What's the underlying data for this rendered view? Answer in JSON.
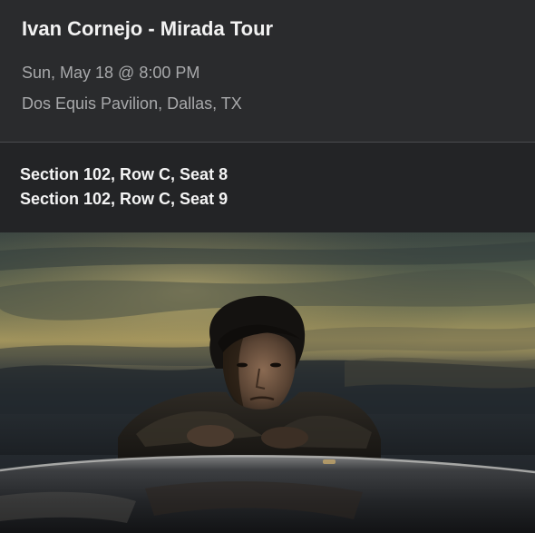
{
  "event": {
    "title": "Ivan Cornejo - Mirada Tour",
    "datetime": "Sun, May 18 @ 8:00 PM",
    "venue": "Dos Equis Pavilion, Dallas, TX"
  },
  "seats": [
    "Section 102, Row C, Seat 8",
    "Section 102, Row C, Seat 9"
  ],
  "hero_image": {
    "subject": "artist-photo",
    "description_icon": "person-leaning-on-car-at-dusk"
  },
  "colors": {
    "background": "#2a2b2d",
    "seat_panel": "#232426",
    "title_text": "#f2f2f2",
    "secondary_text": "#a8a9ab"
  }
}
